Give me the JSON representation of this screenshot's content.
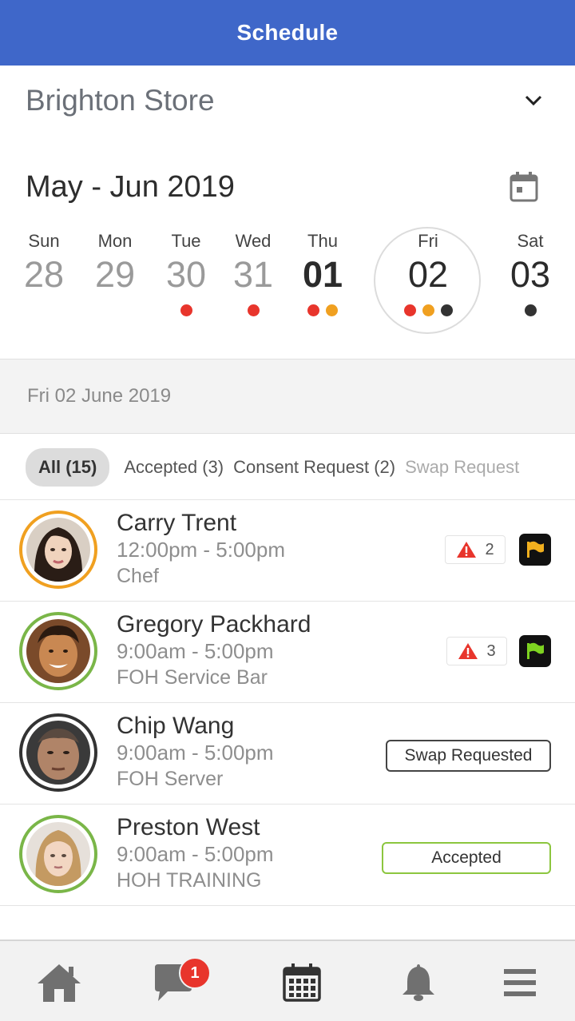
{
  "header": {
    "title": "Schedule"
  },
  "store": {
    "name": "Brighton Store",
    "dropdown_icon": "chevron-down-icon"
  },
  "calendar": {
    "month_label": "May - Jun 2019",
    "calendar_icon": "calendar-icon",
    "days": [
      {
        "name": "Sun",
        "num": "28",
        "dots": []
      },
      {
        "name": "Mon",
        "num": "29",
        "dots": []
      },
      {
        "name": "Tue",
        "num": "30",
        "dots": [
          "#e8352c"
        ]
      },
      {
        "name": "Wed",
        "num": "31",
        "dots": [
          "#e8352c"
        ]
      },
      {
        "name": "Thu",
        "num": "01",
        "dots": [
          "#e8352c",
          "#f0a020"
        ],
        "state": "today"
      },
      {
        "name": "Fri",
        "num": "02",
        "dots": [
          "#e8352c",
          "#f0a020",
          "#333333"
        ],
        "state": "selected"
      },
      {
        "name": "Sat",
        "num": "03",
        "dots": [
          "#333333"
        ]
      }
    ]
  },
  "date_header": "Fri 02 June 2019",
  "filters": [
    {
      "label": "All (15)",
      "active": true
    },
    {
      "label": "Accepted (3)"
    },
    {
      "label": "Consent Request (2)"
    },
    {
      "label": "Swap Request"
    }
  ],
  "shifts": [
    {
      "name": "Carry Trent",
      "time": "12:00pm - 5:00pm",
      "role": "Chef",
      "ring_color": "#f0a020",
      "warnings": "2",
      "flag_color": "#f2b01e"
    },
    {
      "name": "Gregory Packhard",
      "time": "9:00am - 5:00pm",
      "role": "FOH Service Bar",
      "ring_color": "#7ab648",
      "warnings": "3",
      "flag_color": "#7ed321"
    },
    {
      "name": "Chip Wang",
      "time": "9:00am - 5:00pm",
      "role": "FOH Server",
      "ring_color": "#333333",
      "status": "Swap Requested"
    },
    {
      "name": "Preston West",
      "time": "9:00am - 5:00pm",
      "role": "HOH TRAINING",
      "ring_color": "#7ab648",
      "status": "Accepted",
      "status_border": "#8cc63f"
    }
  ],
  "tabbar": {
    "items": [
      "home-icon",
      "chat-icon",
      "calendar-icon",
      "bell-icon",
      "menu-icon"
    ],
    "chat_badge": "1"
  },
  "colors": {
    "primary": "#3f67c9",
    "alert": "#e8352c"
  }
}
